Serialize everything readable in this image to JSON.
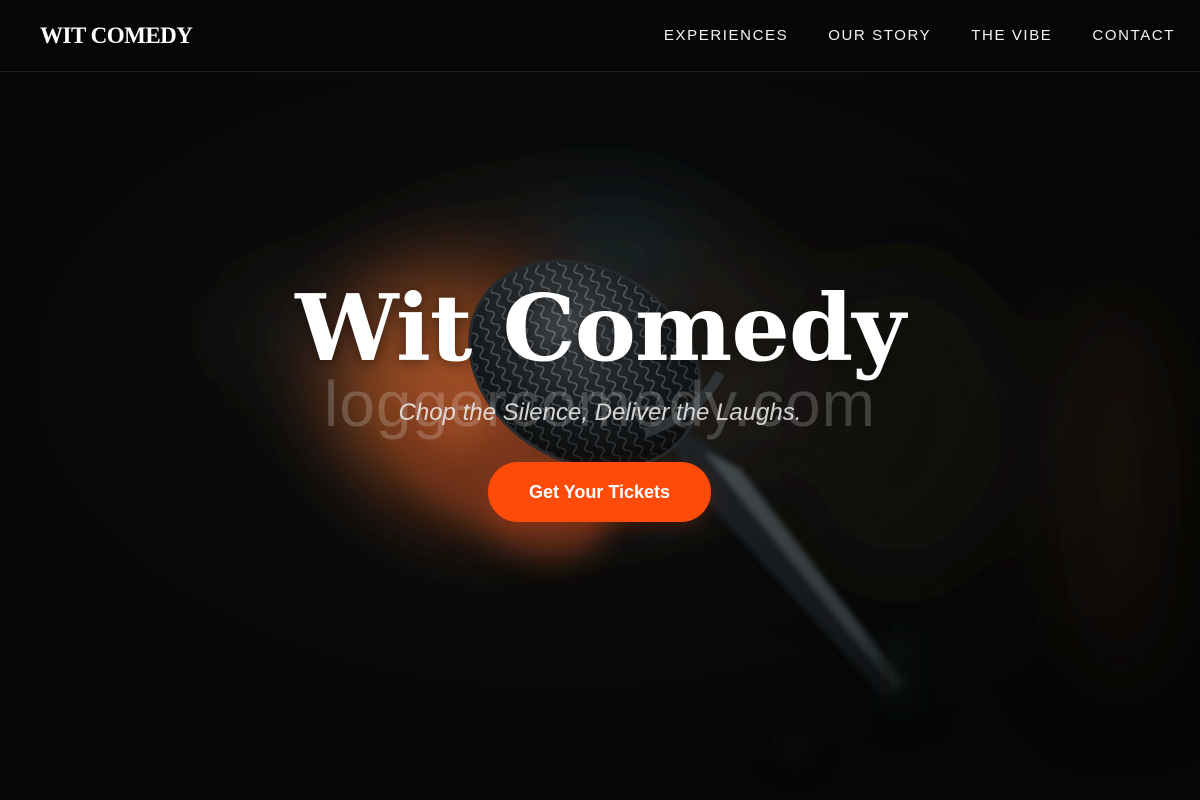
{
  "header": {
    "brand": "WIT COMEDY",
    "nav": [
      {
        "label": "EXPERIENCES"
      },
      {
        "label": "OUR STORY"
      },
      {
        "label": "THE VIBE"
      },
      {
        "label": "CONTACT"
      }
    ]
  },
  "hero": {
    "title": "Wit Comedy",
    "tagline": "Chop the Silence, Deliver the Laughs.",
    "cta_label": "Get Your Tickets",
    "watermark": "loggercomedy.com",
    "background_icon": "microphone-icon"
  },
  "colors": {
    "accent": "#ff4b0a",
    "navbar_bg": "#060606",
    "page_bg": "#0b0b0c",
    "text": "#ffffff"
  }
}
